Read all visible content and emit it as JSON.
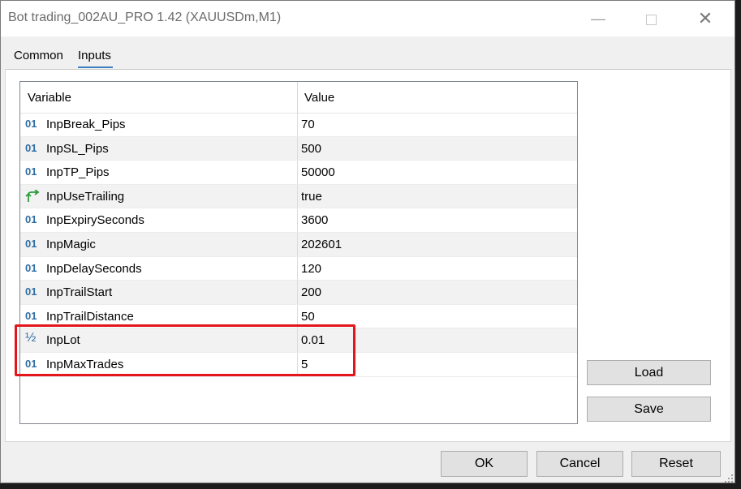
{
  "window": {
    "title": "Bot trading_002AU_PRO 1.42 (XAUUSDm,M1)",
    "minimize_glyph": "—",
    "close_glyph": "✕"
  },
  "tabs": [
    {
      "label": "Common",
      "selected": false
    },
    {
      "label": "Inputs",
      "selected": true
    }
  ],
  "grid": {
    "headers": {
      "variable": "Variable",
      "value": "Value"
    },
    "rows": [
      {
        "icon": "integer-icon",
        "icon_text": "01",
        "name": "InpBreak_Pips",
        "value": "70"
      },
      {
        "icon": "integer-icon",
        "icon_text": "01",
        "name": "InpSL_Pips",
        "value": "500"
      },
      {
        "icon": "integer-icon",
        "icon_text": "01",
        "name": "InpTP_Pips",
        "value": "50000"
      },
      {
        "icon": "boolean-arrow-icon",
        "icon_text": "",
        "name": "InpUseTrailing",
        "value": "true"
      },
      {
        "icon": "integer-icon",
        "icon_text": "01",
        "name": "InpExpirySeconds",
        "value": "3600"
      },
      {
        "icon": "integer-icon",
        "icon_text": "01",
        "name": "InpMagic",
        "value": "202601"
      },
      {
        "icon": "integer-icon",
        "icon_text": "01",
        "name": "InpDelaySeconds",
        "value": "120"
      },
      {
        "icon": "integer-icon",
        "icon_text": "01",
        "name": "InpTrailStart",
        "value": "200"
      },
      {
        "icon": "integer-icon",
        "icon_text": "01",
        "name": "InpTrailDistance",
        "value": "50"
      },
      {
        "icon": "double-half-icon",
        "icon_text": "½",
        "name": "InpLot",
        "value": "0.01"
      },
      {
        "icon": "integer-icon",
        "icon_text": "01",
        "name": "InpMaxTrades",
        "value": "5"
      }
    ]
  },
  "buttons": {
    "load": "Load",
    "save": "Save",
    "ok": "OK",
    "cancel": "Cancel",
    "reset": "Reset"
  },
  "colors": {
    "highlight_border": "#e3161b",
    "integer_icon": "#2f6ea3",
    "boolean_icon": "#2a9d3a",
    "tab_underline": "#3c7fc1"
  }
}
